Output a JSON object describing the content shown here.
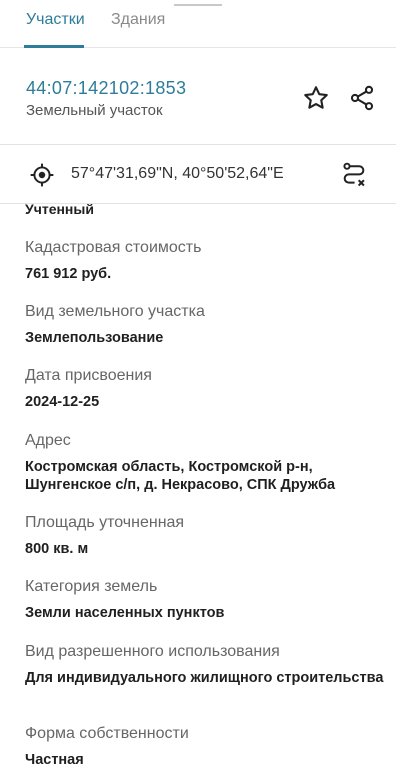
{
  "tabs": [
    {
      "label": "Участки",
      "active": true
    },
    {
      "label": "Здания",
      "active": false
    }
  ],
  "header": {
    "cadastral_number": "44:07:142102:1853",
    "object_type": "Земельный участок",
    "favorite_icon": "star-outline-icon",
    "share_icon": "share-icon"
  },
  "coords": {
    "text": "57°47'31,69\"N, 40°50'52,64\"E",
    "locate_icon": "crosshair-icon",
    "route_icon": "route-icon"
  },
  "status_value": "Учтенный",
  "fields": [
    {
      "label": "Кадастровая стоимость",
      "value": "761 912 руб."
    },
    {
      "label": "Вид земельного участка",
      "value": "Землепользование"
    },
    {
      "label": "Дата присвоения",
      "value": "2024-12-25"
    },
    {
      "label": "Адрес",
      "value": "Костромская область, Костромской р-н, Шунгенское с/п, д. Некрасово, СПК Дружба"
    },
    {
      "label": "Площадь уточненная",
      "value": "800 кв. м"
    },
    {
      "label": "Категория земель",
      "value": "Земли населенных пунктов"
    },
    {
      "label": "Вид разрешенного использования",
      "value": "Для индивидуального жилищного строительства"
    },
    {
      "label": "Форма собственности",
      "value": "Частная"
    }
  ],
  "colors": {
    "accent": "#2d7d9a",
    "text": "#1f1f1f",
    "muted": "#666666"
  }
}
